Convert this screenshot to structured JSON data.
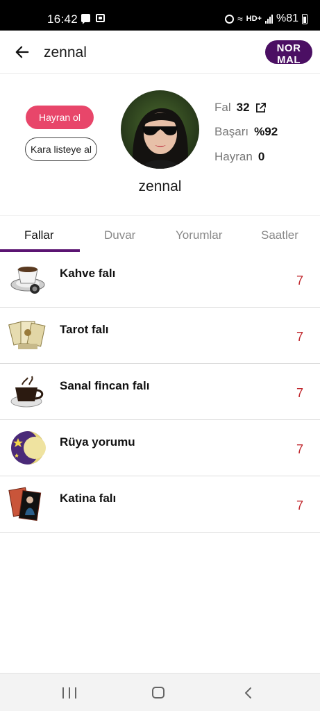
{
  "status_bar": {
    "time": "16:42",
    "network_label": "HD+",
    "battery": "%81",
    "icons": [
      "message-icon",
      "app-notification-icon",
      "alarm-icon",
      "wifi-icon",
      "signal-icon",
      "battery-icon"
    ]
  },
  "header": {
    "title": "zennal",
    "badge_label": "NOR MAL",
    "back_icon": "arrow-left-icon"
  },
  "profile": {
    "follow_label": "Hayran ol",
    "blacklist_label": "Kara listeye al",
    "username": "zennal",
    "stats": {
      "fal_label": "Fal",
      "fal_value": "32",
      "basari_label": "Başarı",
      "basari_value": "%92",
      "hayran_label": "Hayran",
      "hayran_value": "0"
    }
  },
  "tabs": [
    {
      "label": "Fallar",
      "active": true
    },
    {
      "label": "Duvar",
      "active": false
    },
    {
      "label": "Yorumlar",
      "active": false
    },
    {
      "label": "Saatler",
      "active": false
    }
  ],
  "fortune_types": [
    {
      "title": "Kahve falı",
      "count": "7",
      "icon": "coffee-cup-icon"
    },
    {
      "title": "Tarot falı",
      "count": "7",
      "icon": "tarot-cards-icon"
    },
    {
      "title": "Sanal fincan falı",
      "count": "7",
      "icon": "virtual-cup-icon"
    },
    {
      "title": "Rüya yorumu",
      "count": "7",
      "icon": "moon-stars-icon"
    },
    {
      "title": "Katina falı",
      "count": "7",
      "icon": "katina-cards-icon"
    }
  ],
  "colors": {
    "brand_purple": "#4b0f63",
    "follow_pink": "#e8466a",
    "count_red": "#c0262c",
    "tab_indicator": "#5b1472"
  }
}
